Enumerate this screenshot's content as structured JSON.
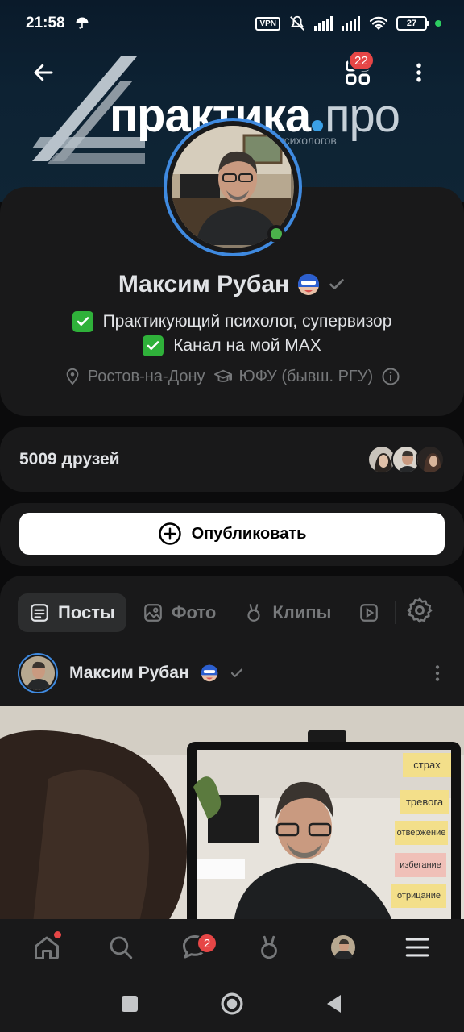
{
  "status_bar": {
    "time": "21:58",
    "vpn": "VPN",
    "battery": "27"
  },
  "cover": {
    "brand_main": "практика",
    "brand_suffix": "про",
    "subtitle": "психологов"
  },
  "header": {
    "apps_badge": "22"
  },
  "profile": {
    "name": "Максим Рубан",
    "status_line_1": "Практикующий психолог, супервизор",
    "status_line_2": "Канал на мой MAX",
    "city": "Ростов-на-Дону",
    "education": "ЮФУ (бывш. РГУ)"
  },
  "friends": {
    "label": "5009 друзей"
  },
  "publish": {
    "label": "Опубликовать"
  },
  "tabs": [
    {
      "label": "Посты",
      "icon": "list-icon"
    },
    {
      "label": "Фото",
      "icon": "image-icon"
    },
    {
      "label": "Клипы",
      "icon": "clips-icon"
    }
  ],
  "post": {
    "author": "Максим Рубан",
    "stickies": [
      "страх",
      "тревога",
      "отвержение",
      "избегание",
      "отрицание"
    ]
  },
  "bottom_nav": {
    "messages_badge": "2"
  },
  "colors": {
    "accent": "#3f8ae0",
    "badge": "#e64646",
    "online": "#4bb34b",
    "card": "#19191a"
  }
}
